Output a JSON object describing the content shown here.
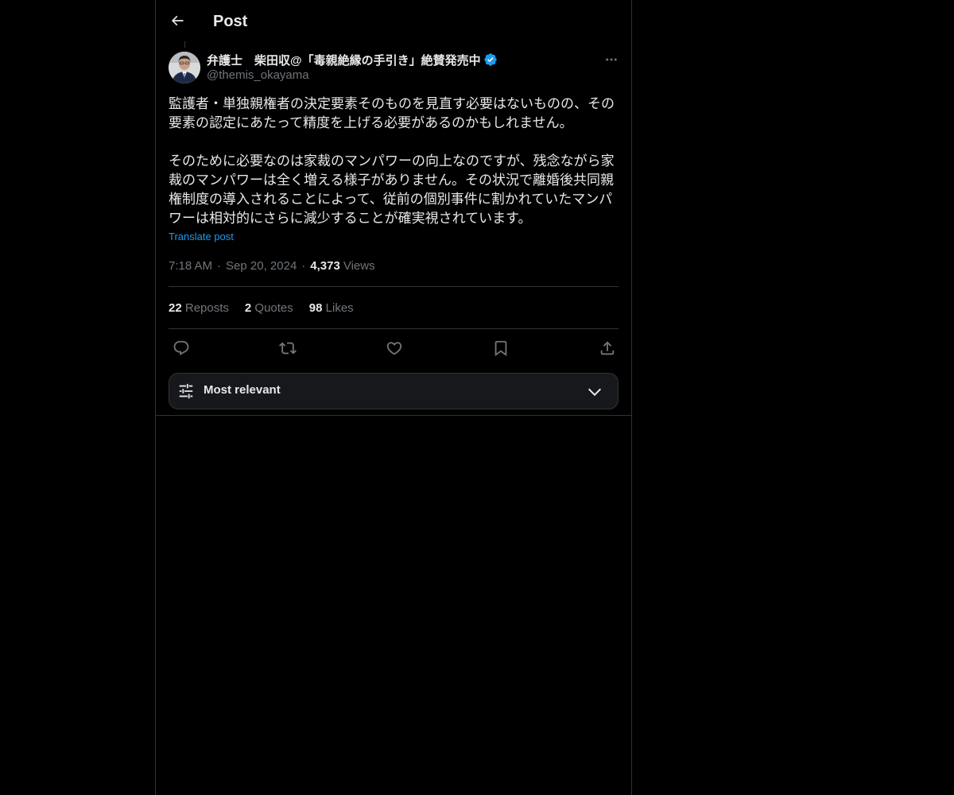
{
  "header": {
    "title": "Post"
  },
  "post": {
    "author": {
      "display_name": "弁護士　柴田収@「毒親絶縁の手引き」絶賛発売中",
      "handle": "@themis_okayama",
      "verified": true
    },
    "paragraphs": [
      "監護者・単独親権者の決定要素そのものを見直す必要はないものの、その要素の認定にあたって精度を上げる必要があるのかもしれません。",
      "そのために必要なのは家裁のマンパワーの向上なのですが、残念ながら家裁のマンパワーは全く増える様子がありません。その状況で離婚後共同親権制度の導入されることによって、従前の個別事件に割かれていたマンパワーは相対的にさらに減少することが確実視されています。"
    ],
    "translate_label": "Translate post",
    "time": "7:18 AM",
    "separator": "·",
    "date": "Sep 20, 2024",
    "views_count": "4,373",
    "views_label": "Views",
    "stats": {
      "reposts_count": "22",
      "reposts_label": "Reposts",
      "quotes_count": "2",
      "quotes_label": "Quotes",
      "likes_count": "98",
      "likes_label": "Likes"
    },
    "actions": [
      "reply-icon",
      "repost-icon",
      "like-icon",
      "bookmark-icon",
      "share-icon"
    ]
  },
  "sort": {
    "label": "Most relevant"
  },
  "colors": {
    "background": "#000000",
    "text": "#e7e9ea",
    "muted": "#71767b",
    "accent": "#1d9bf0",
    "border": "#2f3336"
  }
}
